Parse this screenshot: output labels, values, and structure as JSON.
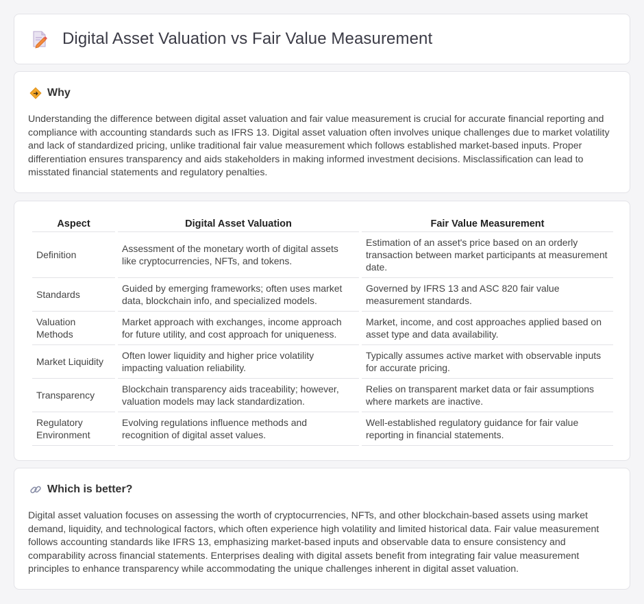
{
  "header": {
    "title": "Digital Asset Valuation vs Fair Value Measurement",
    "icon": "document-pencil-icon"
  },
  "why": {
    "title": "Why",
    "icon": "diamond-sign-icon",
    "text": "Understanding the difference between digital asset valuation and fair value measurement is crucial for accurate financial reporting and compliance with accounting standards such as IFRS 13. Digital asset valuation often involves unique challenges due to market volatility and lack of standardized pricing, unlike traditional fair value measurement which follows established market-based inputs. Proper differentiation ensures transparency and aids stakeholders in making informed investment decisions. Misclassification can lead to misstated financial statements and regulatory penalties."
  },
  "table": {
    "headers": [
      "Aspect",
      "Digital Asset Valuation",
      "Fair Value Measurement"
    ],
    "rows": [
      [
        "Definition",
        "Assessment of the monetary worth of digital assets like cryptocurrencies, NFTs, and tokens.",
        "Estimation of an asset's price based on an orderly transaction between market participants at measurement date."
      ],
      [
        "Standards",
        "Guided by emerging frameworks; often uses market data, blockchain info, and specialized models.",
        "Governed by IFRS 13 and ASC 820 fair value measurement standards."
      ],
      [
        "Valuation Methods",
        "Market approach with exchanges, income approach for future utility, and cost approach for uniqueness.",
        "Market, income, and cost approaches applied based on asset type and data availability."
      ],
      [
        "Market Liquidity",
        "Often lower liquidity and higher price volatility impacting valuation reliability.",
        "Typically assumes active market with observable inputs for accurate pricing."
      ],
      [
        "Transparency",
        "Blockchain transparency aids traceability; however, valuation models may lack standardization.",
        "Relies on transparent market data or fair assumptions where markets are inactive."
      ],
      [
        "Regulatory Environment",
        "Evolving regulations influence methods and recognition of digital asset values.",
        "Well-established regulatory guidance for fair value reporting in financial statements."
      ]
    ]
  },
  "better": {
    "title": "Which is better?",
    "icon": "link-icon",
    "text": "Digital asset valuation focuses on assessing the worth of cryptocurrencies, NFTs, and other blockchain-based assets using market demand, liquidity, and technological factors, which often experience high volatility and limited historical data. Fair value measurement follows accounting standards like IFRS 13, emphasizing market-based inputs and observable data to ensure consistency and comparability across financial statements. Enterprises dealing with digital assets benefit from integrating fair value measurement principles to enhance transparency while accommodating the unique challenges inherent in digital asset valuation."
  }
}
